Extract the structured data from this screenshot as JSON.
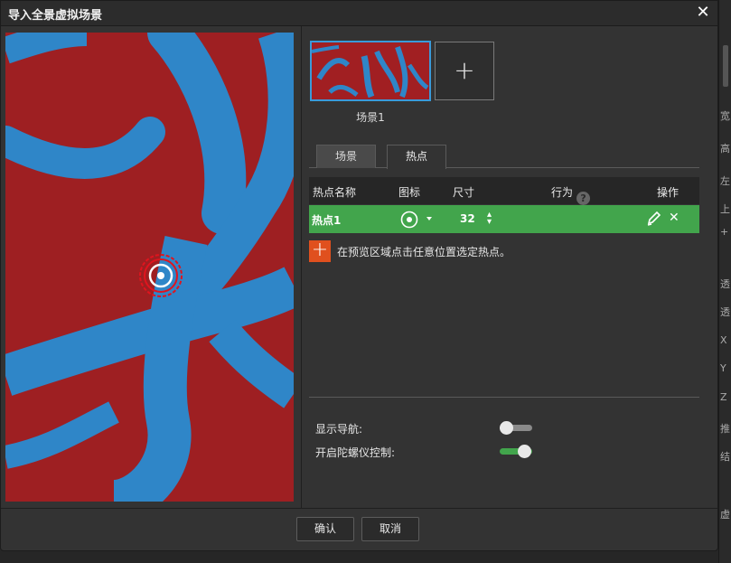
{
  "dialog": {
    "title": "导入全景虚拟场景",
    "close_icon": "close-icon"
  },
  "scenes": {
    "items": [
      {
        "label": "场景1",
        "selected": true
      }
    ],
    "add_label": "+"
  },
  "tabs": [
    {
      "label": "场景",
      "active": false
    },
    {
      "label": "热点",
      "active": true
    }
  ],
  "hotspot_table": {
    "columns": [
      "热点名称",
      "图标",
      "尺寸",
      "行为",
      "操作"
    ],
    "help_icon": "?",
    "rows": [
      {
        "name": "热点1",
        "icon": "target-icon",
        "size": "32",
        "behavior": "",
        "highlight": "#42a54c"
      }
    ]
  },
  "hint": {
    "plus": "+",
    "text": "在预览区域点击任意位置选定热点。"
  },
  "options": [
    {
      "label": "显示导航:",
      "on": false
    },
    {
      "label": "开启陀螺仪控制:",
      "on": true
    }
  ],
  "footer": {
    "confirm_label": "确认",
    "cancel_label": "取消"
  },
  "colors": {
    "accent": "#3a9ad9",
    "active_row": "#42a54c",
    "add_hotspot": "#e0501e",
    "panorama_red": "#9e1f22",
    "panorama_blue": "#2f86c8",
    "hotspot_marker": "#e0141e"
  },
  "right_edge_chars": [
    "宽",
    "高",
    "左",
    "上",
    "+",
    "透",
    "透",
    "X",
    "Y",
    "Z",
    "推",
    "结",
    "虚"
  ]
}
